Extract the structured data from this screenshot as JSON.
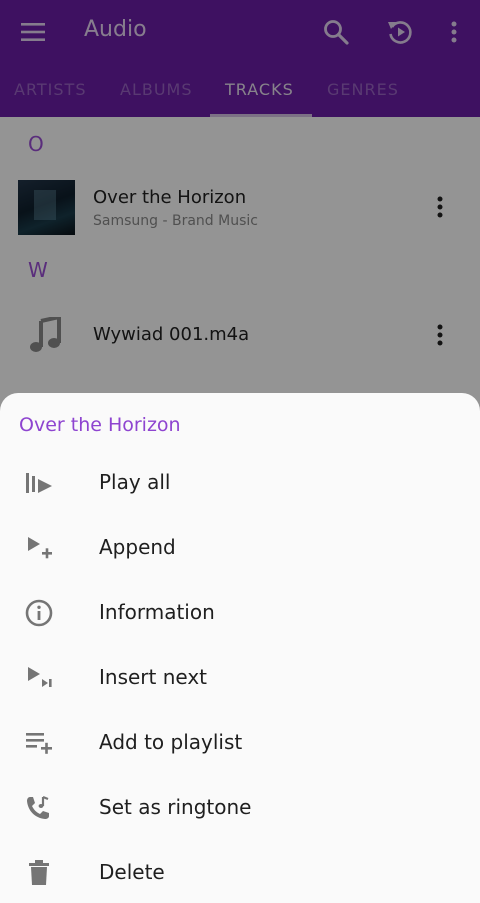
{
  "app_bar": {
    "title": "Audio",
    "icons": [
      "menu-icon",
      "search-icon",
      "resume-playback-icon",
      "more-vert-icon"
    ],
    "color": "#6b1ea8"
  },
  "tabs": [
    {
      "label": "ARTISTS",
      "active": false
    },
    {
      "label": "ALBUMS",
      "active": false
    },
    {
      "label": "TRACKS",
      "active": true
    },
    {
      "label": "GENRES",
      "active": false
    }
  ],
  "list": {
    "sections": [
      {
        "letter": "O"
      },
      {
        "letter": "W"
      }
    ],
    "tracks": [
      {
        "title": "Over the Horizon",
        "subtitle": "Samsung - Brand Music",
        "artwork": "album-art"
      },
      {
        "title": "Wywiad 001.m4a",
        "subtitle": "",
        "artwork": "music-note-icon"
      }
    ]
  },
  "sheet": {
    "title": "Over the Horizon",
    "items": [
      {
        "label": "Play all",
        "icon": "play-all-icon"
      },
      {
        "label": "Append",
        "icon": "append-icon"
      },
      {
        "label": "Information",
        "icon": "info-icon"
      },
      {
        "label": "Insert next",
        "icon": "insert-next-icon"
      },
      {
        "label": "Add to playlist",
        "icon": "playlist-add-icon"
      },
      {
        "label": "Set as ringtone",
        "icon": "ringtone-icon"
      },
      {
        "label": "Delete",
        "icon": "delete-icon"
      }
    ]
  },
  "colors": {
    "accent": "#9b4fd6",
    "sheet_title": "#8e44d0",
    "icon_gray": "#757575"
  }
}
